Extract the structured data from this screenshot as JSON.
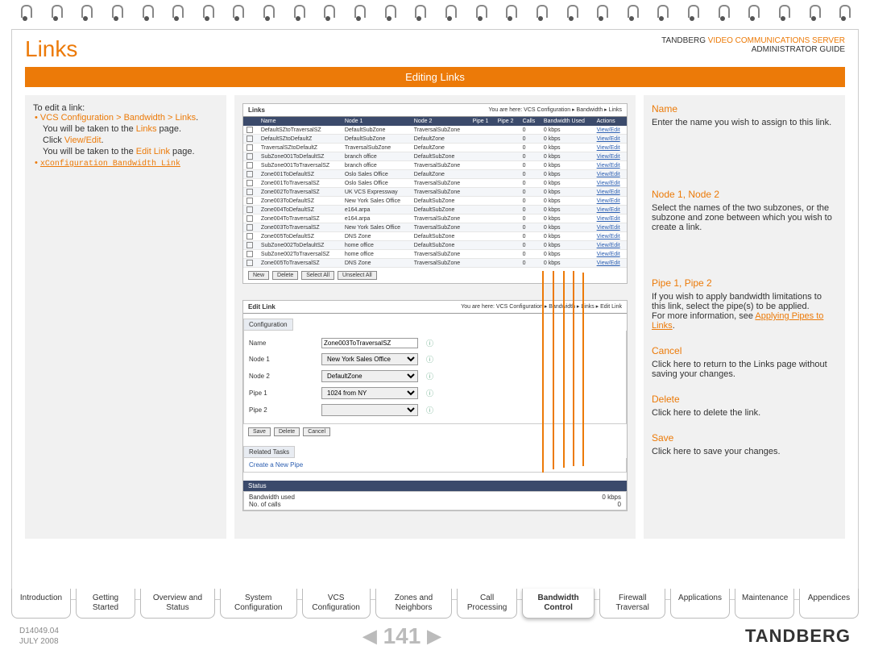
{
  "header": {
    "title": "Links",
    "brand_prefix": "TANDBERG ",
    "brand_product": "VIDEO COMMUNICATIONS SERVER",
    "guide": "ADMINISTRATOR GUIDE",
    "section_bar": "Editing Links"
  },
  "left": {
    "intro": "To edit a link:",
    "nav_path": "VCS Configuration > Bandwidth > Links",
    "line1a": "You will be taken to the ",
    "line1b": "Links",
    "line1c": " page.",
    "line2a": "Click ",
    "line2b": "View/Edit",
    "line2c": ".",
    "line3a": "You will be taken to the ",
    "line3b": "Edit Link",
    "line3c": " page.",
    "cmd": "xConfiguration Bandwidth Link"
  },
  "links_table": {
    "title": "Links",
    "breadcrumb": "You are here: VCS Configuration ▸ Bandwidth ▸ Links",
    "headers": [
      "",
      "Name",
      "Node 1",
      "Node 2",
      "Pipe 1",
      "Pipe 2",
      "Calls",
      "Bandwidth Used",
      "Actions"
    ],
    "rows": [
      [
        "DefaultSZtoTraversalSZ",
        "DefaultSubZone",
        "TraversalSubZone",
        "",
        "",
        "0",
        "0 kbps",
        "View/Edit"
      ],
      [
        "DefaultSZtoDefaultZ",
        "DefaultSubZone",
        "DefaultZone",
        "",
        "",
        "0",
        "0 kbps",
        "View/Edit"
      ],
      [
        "TraversalSZtoDefaultZ",
        "TraversalSubZone",
        "DefaultZone",
        "",
        "",
        "0",
        "0 kbps",
        "View/Edit"
      ],
      [
        "SubZone001ToDefaultSZ",
        "branch office",
        "DefaultSubZone",
        "",
        "",
        "0",
        "0 kbps",
        "View/Edit"
      ],
      [
        "SubZone001ToTraversalSZ",
        "branch office",
        "TraversalSubZone",
        "",
        "",
        "0",
        "0 kbps",
        "View/Edit"
      ],
      [
        "Zone001ToDefaultSZ",
        "Oslo Sales Office",
        "DefaultZone",
        "",
        "",
        "0",
        "0 kbps",
        "View/Edit"
      ],
      [
        "Zone001ToTraversalSZ",
        "Oslo Sales Office",
        "TraversalSubZone",
        "",
        "",
        "0",
        "0 kbps",
        "View/Edit"
      ],
      [
        "Zone002ToTraversalSZ",
        "UK VCS Expressway",
        "TraversalSubZone",
        "",
        "",
        "0",
        "0 kbps",
        "View/Edit"
      ],
      [
        "Zone003ToDefaultSZ",
        "New York Sales Office",
        "DefaultSubZone",
        "",
        "",
        "0",
        "0 kbps",
        "View/Edit"
      ],
      [
        "Zone004ToDefaultSZ",
        "e164.arpa",
        "DefaultSubZone",
        "",
        "",
        "0",
        "0 kbps",
        "View/Edit"
      ],
      [
        "Zone004ToTraversalSZ",
        "e164.arpa",
        "TraversalSubZone",
        "",
        "",
        "0",
        "0 kbps",
        "View/Edit"
      ],
      [
        "Zone003ToTraversalSZ",
        "New York Sales Office",
        "TraversalSubZone",
        "",
        "",
        "0",
        "0 kbps",
        "View/Edit"
      ],
      [
        "Zone005ToDefaultSZ",
        "DNS Zone",
        "DefaultSubZone",
        "",
        "",
        "0",
        "0 kbps",
        "View/Edit"
      ],
      [
        "SubZone002ToDefaultSZ",
        "home office",
        "DefaultSubZone",
        "",
        "",
        "0",
        "0 kbps",
        "View/Edit"
      ],
      [
        "SubZone002ToTraversalSZ",
        "home office",
        "TraversalSubZone",
        "",
        "",
        "0",
        "0 kbps",
        "View/Edit"
      ],
      [
        "Zone005ToTraversalSZ",
        "DNS Zone",
        "TraversalSubZone",
        "",
        "",
        "0",
        "0 kbps",
        "View/Edit"
      ]
    ],
    "buttons": {
      "new": "New",
      "delete": "Delete",
      "selectall": "Select All",
      "unselectall": "Unselect All"
    }
  },
  "edit_link": {
    "title": "Edit Link",
    "breadcrumb": "You are here: VCS Configuration ▸ Bandwidth ▸ Links ▸ Edit Link",
    "config_tab": "Configuration",
    "fields": {
      "name_label": "Name",
      "name_value": "Zone003ToTraversalSZ",
      "node1_label": "Node 1",
      "node1_value": "New York Sales Office",
      "node2_label": "Node 2",
      "node2_value": "DefaultZone",
      "pipe1_label": "Pipe 1",
      "pipe1_value": "1024 from NY",
      "pipe2_label": "Pipe 2",
      "pipe2_value": ""
    },
    "buttons": {
      "save": "Save",
      "delete": "Delete",
      "cancel": "Cancel"
    },
    "related_title": "Related Tasks",
    "related_link": "Create a New Pipe",
    "status_title": "Status",
    "status_rows": [
      [
        "Bandwidth used",
        "0 kbps"
      ],
      [
        "No. of calls",
        "0"
      ]
    ]
  },
  "right": {
    "name_h": "Name",
    "name_body": "Enter the name you wish to assign to this link.",
    "node_h": "Node 1, Node 2",
    "node_body": "Select the names of the two subzones, or the subzone and zone between which you wish to create a link.",
    "pipe_h": "Pipe 1, Pipe 2",
    "pipe_body1": "If you wish to apply bandwidth limitations to this link, select the pipe(s) to be applied.",
    "pipe_body2a": "For more information, see ",
    "pipe_link": "Applying Pipes to Links",
    "pipe_body2b": ".",
    "cancel_h": "Cancel",
    "cancel_body": "Click here to return to the Links page without saving your changes.",
    "delete_h": "Delete",
    "delete_body": "Click here to delete the link.",
    "save_h": "Save",
    "save_body": "Click here to save your changes."
  },
  "tabs": [
    "Introduction",
    "Getting Started",
    "Overview and Status",
    "System Configuration",
    "VCS Configuration",
    "Zones and Neighbors",
    "Call Processing",
    "Bandwidth Control",
    "Firewall Traversal",
    "Applications",
    "Maintenance",
    "Appendices"
  ],
  "tabs_active_index": 7,
  "footer": {
    "doc": "D14049.04",
    "date": "JULY 2008",
    "page": "141",
    "brand": "TANDBERG"
  }
}
